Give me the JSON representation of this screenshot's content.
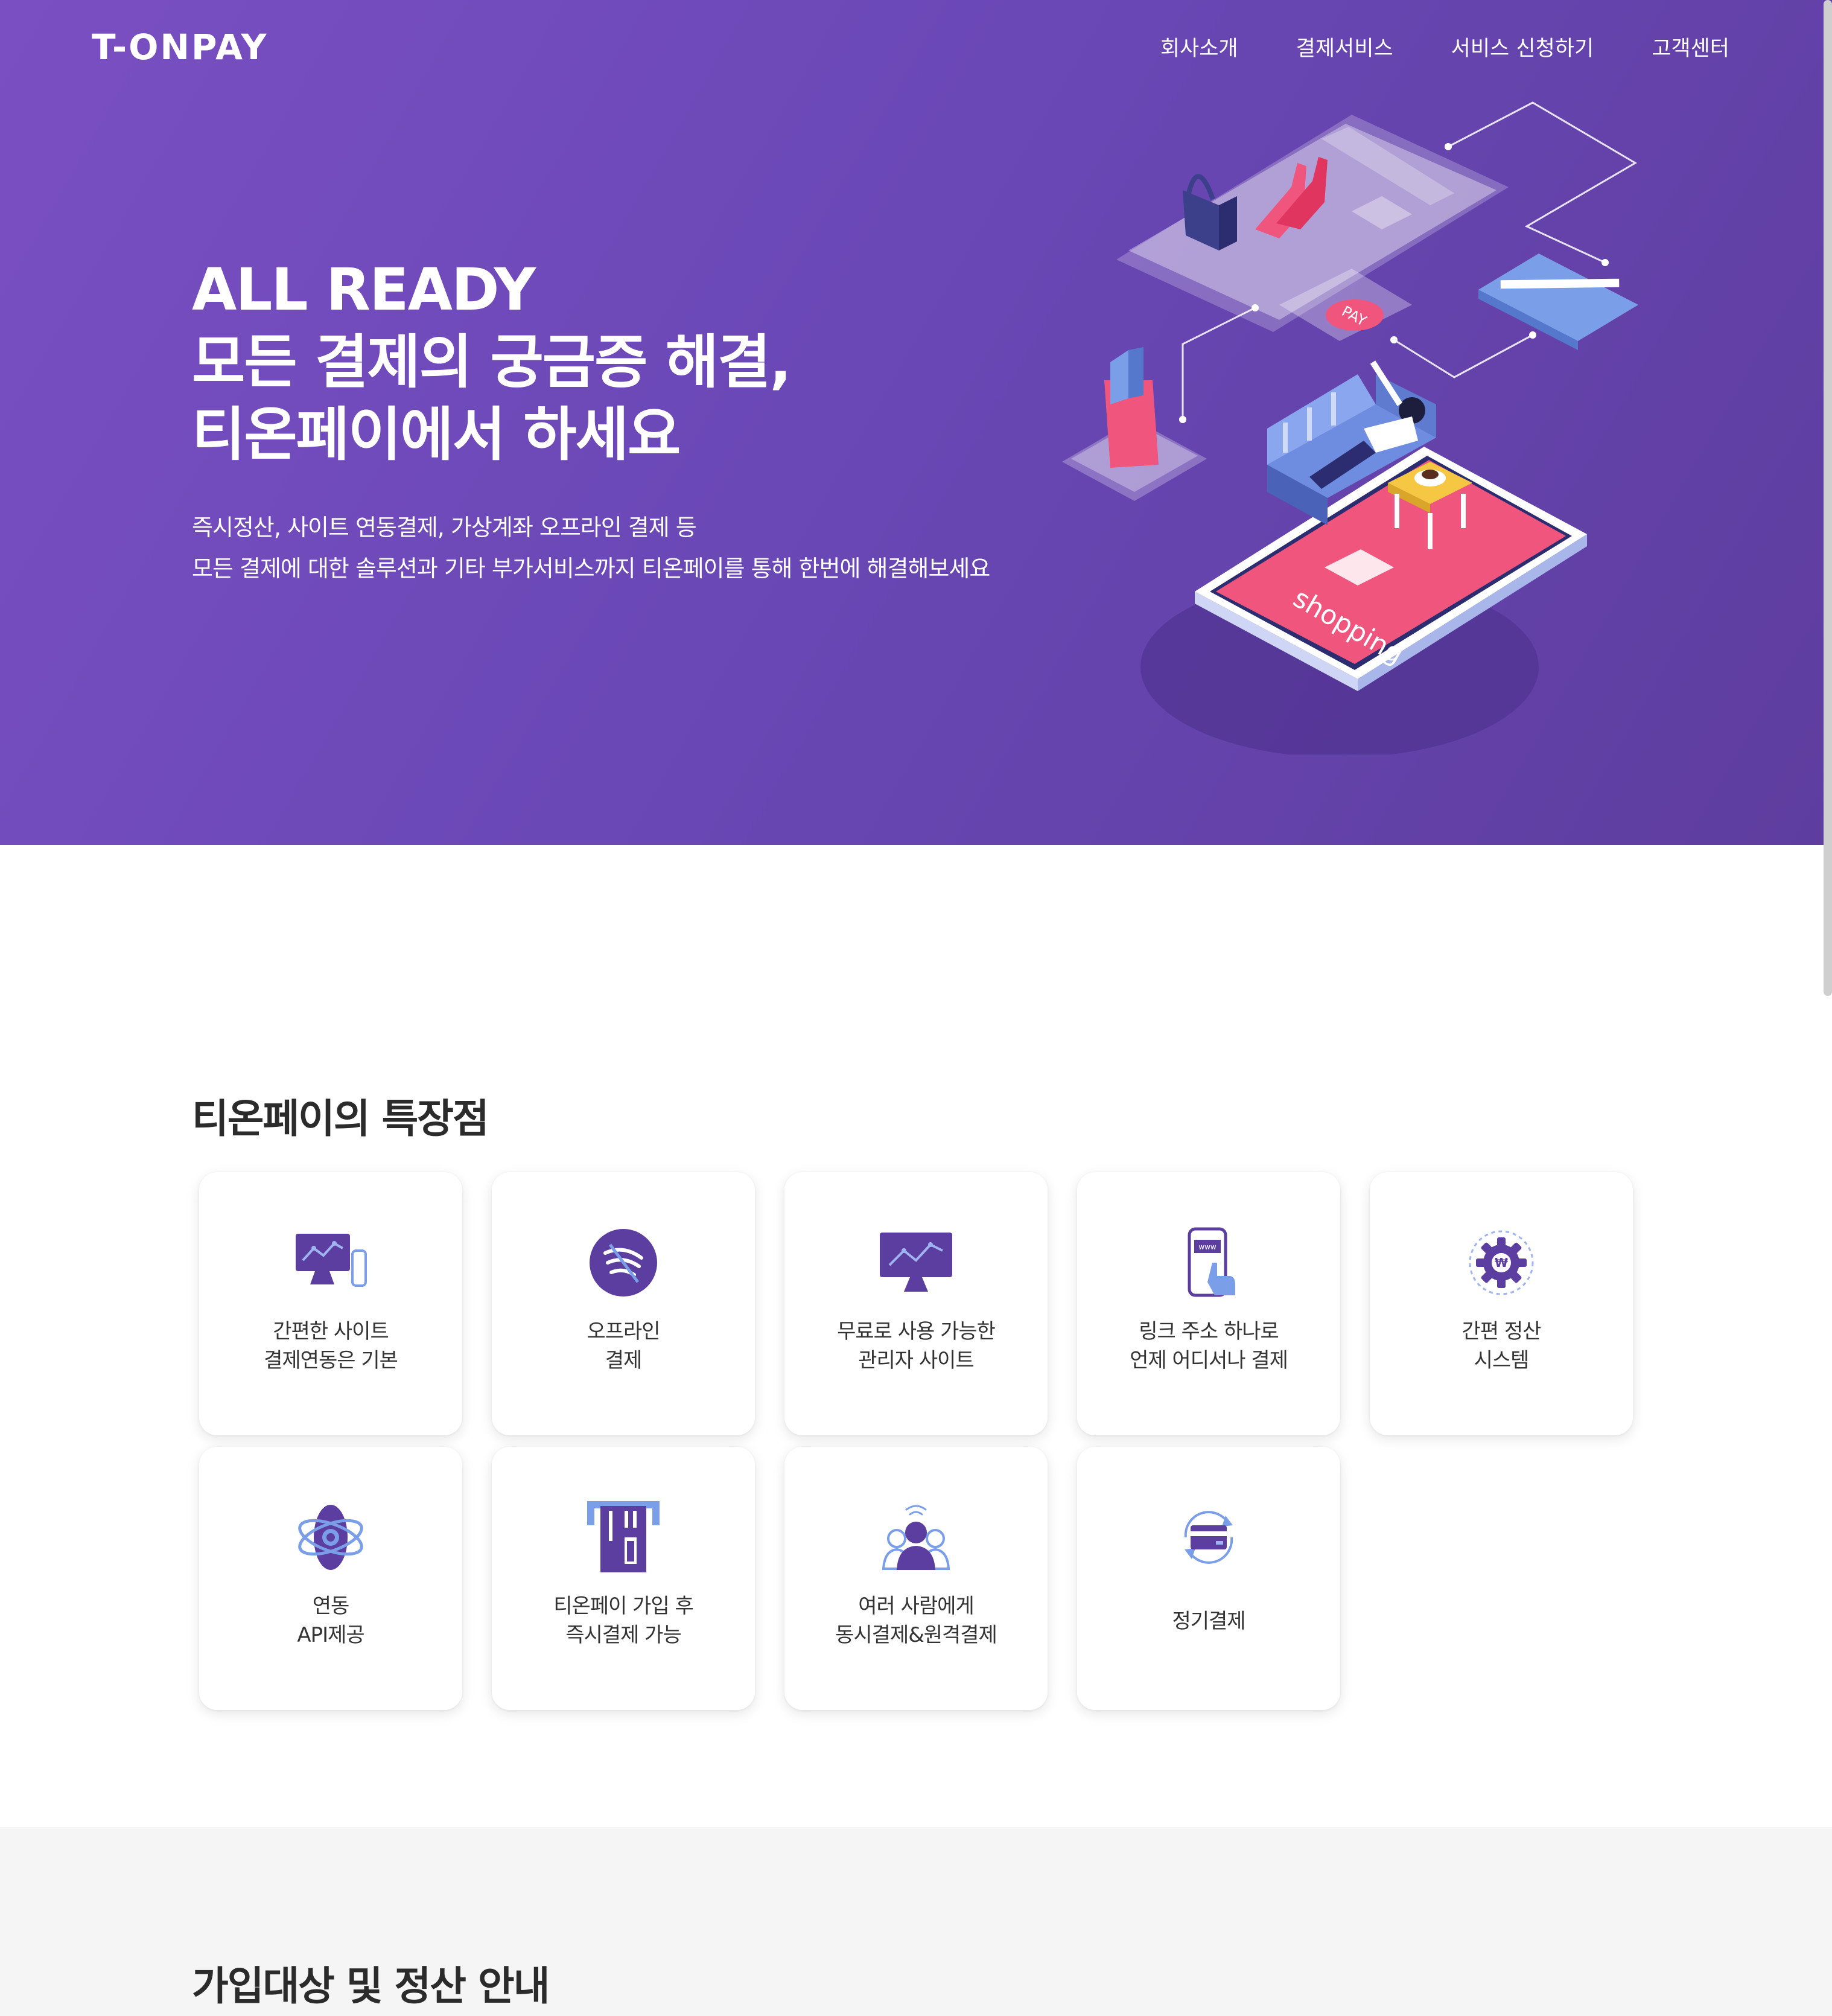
{
  "header": {
    "logo": "T-ONPAY",
    "nav": [
      "회사소개",
      "결제서비스",
      "서비스 신청하기",
      "고객센터"
    ]
  },
  "hero": {
    "title_lines": [
      "ALL READY",
      "모든 결제의 궁금증 해결,",
      "티온페이에서 하세요"
    ],
    "desc_lines": [
      "즉시정산, 사이트 연동결제, 가상계좌 오프라인 결제 등",
      "모든 결제에 대한 솔루션과 기타 부가서비스까지 티온페이를 통해 한번에 해결해보세요"
    ],
    "illustration": {
      "pay_badge": "PAY",
      "phone_text": "shopping"
    }
  },
  "features": {
    "title": "티온페이의 특장점",
    "items": [
      {
        "icon": "monitor-phone-chart-icon",
        "lines": [
          "간편한 사이트",
          "결제연동은 기본"
        ]
      },
      {
        "icon": "contactless-pay-icon",
        "lines": [
          "오프라인",
          "결제"
        ]
      },
      {
        "icon": "monitor-chart-icon",
        "lines": [
          "무료로 사용 가능한",
          "관리자 사이트"
        ]
      },
      {
        "icon": "phone-link-icon",
        "lines": [
          "링크 주소 하나로",
          "언제 어디서나 결제"
        ],
        "icon_text": "www"
      },
      {
        "icon": "gear-won-icon",
        "lines": [
          "간편 정산",
          "시스템"
        ],
        "icon_text": "₩"
      },
      {
        "icon": "atom-api-icon",
        "lines": [
          "연동",
          "API제공"
        ]
      },
      {
        "icon": "card-terminal-icon",
        "lines": [
          "티온페이 가입 후",
          "즉시결제 가능"
        ]
      },
      {
        "icon": "people-signal-icon",
        "lines": [
          "여러 사람에게",
          "동시결제&원격결제"
        ]
      },
      {
        "icon": "recurring-card-icon",
        "lines": [
          "정기결제"
        ]
      }
    ]
  },
  "info": {
    "title": "가입대상 및 정산 안내"
  },
  "colors": {
    "hero_bg": "#6a48b6",
    "accent_purple": "#5b3ea0",
    "accent_blue": "#7a9ee8",
    "accent_pink": "#f0567d"
  }
}
